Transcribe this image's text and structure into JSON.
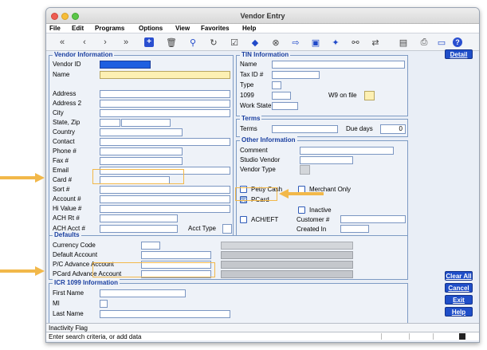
{
  "window": {
    "title": "Vendor Entry"
  },
  "menu": [
    "File",
    "Edit",
    "Programs",
    "Options",
    "View",
    "Favorites",
    "Help"
  ],
  "toolbar_icons": [
    "first-icon",
    "prev-icon",
    "next-icon",
    "last-icon",
    "add-icon",
    "delete-icon",
    "search-icon",
    "refresh-icon",
    "check-icon",
    "eraser-icon",
    "cancel-icon",
    "exit-icon",
    "card-icon",
    "pointer-icon",
    "zoom-icon",
    "swap-icon",
    "notes-icon",
    "print-icon",
    "screen-icon",
    "help-icon"
  ],
  "vendor_info": {
    "title": "Vendor Information",
    "vendor_id": "Vendor ID",
    "name": "Name",
    "address": "Address",
    "address2": "Address 2",
    "city": "City",
    "state_zip": "State, Zip",
    "country": "Country",
    "contact": "Contact",
    "phone": "Phone #",
    "fax": "Fax  #",
    "email": "Email",
    "card": "Card #",
    "sort": "Sort #",
    "account": "Account #",
    "hi_value": "Hi Value #",
    "ach_rt": "ACH Rt #",
    "ach_acct": "ACH Acct #",
    "acct_type": "Acct Type"
  },
  "tin_info": {
    "title": "TIN Information",
    "name": "Name",
    "tax_id": "Tax ID #",
    "type": "Type",
    "f1099": "1099",
    "w9": "W9 on file",
    "work_state": "Work State"
  },
  "terms": {
    "title": "Terms",
    "terms": "Terms",
    "due_days": "Due days",
    "due_value": "0"
  },
  "other_info": {
    "title": "Other Information",
    "comment": "Comment",
    "studio_vendor": "Studio Vendor",
    "vendor_type": "Vendor Type",
    "petty_cash": "Petty Cash",
    "merchant_only": "Merchant Only",
    "pcard": "PCard",
    "inactive": "Inactive",
    "ach_eft": "ACH/EFT",
    "customer": "Customer #",
    "created_in": "Created In"
  },
  "defaults": {
    "title": "Defaults",
    "currency": "Currency Code",
    "default_account": "Default Account",
    "pc_advance": "P/C Advance Account",
    "pcard_advance": "PCard Advance Account"
  },
  "icr": {
    "title": "ICR 1099 Information",
    "first_name": "First Name",
    "mi": "MI",
    "last_name": "Last Name"
  },
  "buttons": {
    "detail": "Detail",
    "clear_all": "Clear All",
    "cancel": "Cancel",
    "exit": "Exit",
    "help": "Help"
  },
  "status": {
    "field_hint": "Inactivity Flag",
    "message": "Enter search criteria, or add data"
  },
  "colors": {
    "accent": "#1f4ec8",
    "highlight": "#f2b84a"
  }
}
